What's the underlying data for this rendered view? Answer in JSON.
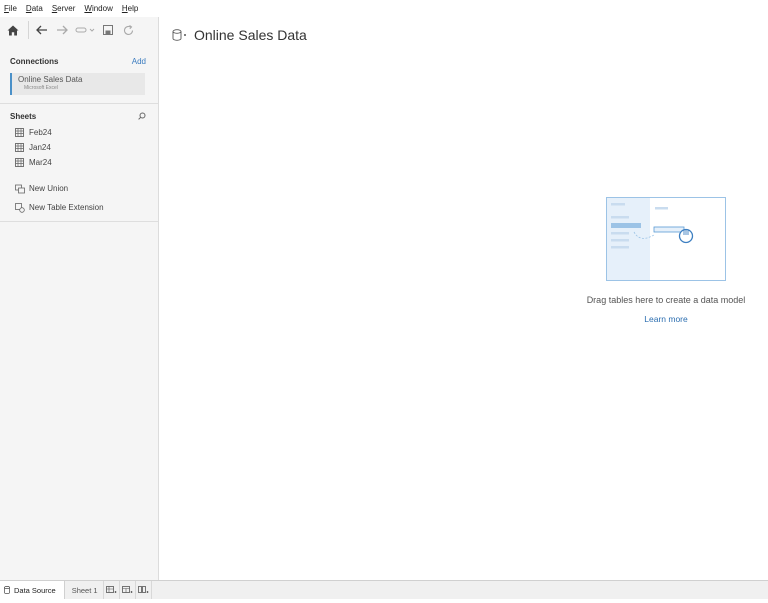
{
  "menu": {
    "items": [
      "File",
      "Data",
      "Server",
      "Window",
      "Help"
    ]
  },
  "toolbar": {
    "icons": [
      "home-icon",
      "back-arrow-icon",
      "forward-arrow-icon",
      "connect-icon",
      "save-icon",
      "refresh-icon"
    ]
  },
  "connections": {
    "header": "Connections",
    "add_label": "Add",
    "items": [
      {
        "name": "Online Sales Data",
        "type": "Microsoft Excel"
      }
    ]
  },
  "sheets": {
    "header": "Sheets",
    "items": [
      "Feb24",
      "Jan24",
      "Mar24"
    ]
  },
  "extras": {
    "new_union": "New Union",
    "new_table_extension": "New Table Extension"
  },
  "main": {
    "title": "Online Sales Data",
    "drag_text": "Drag tables here to create a data model",
    "learn_more": "Learn more"
  },
  "tabs": {
    "data_source": "Data Source",
    "sheet1": "Sheet 1"
  },
  "colors": {
    "accent": "#4a90c8",
    "link": "#2c6eb0"
  }
}
